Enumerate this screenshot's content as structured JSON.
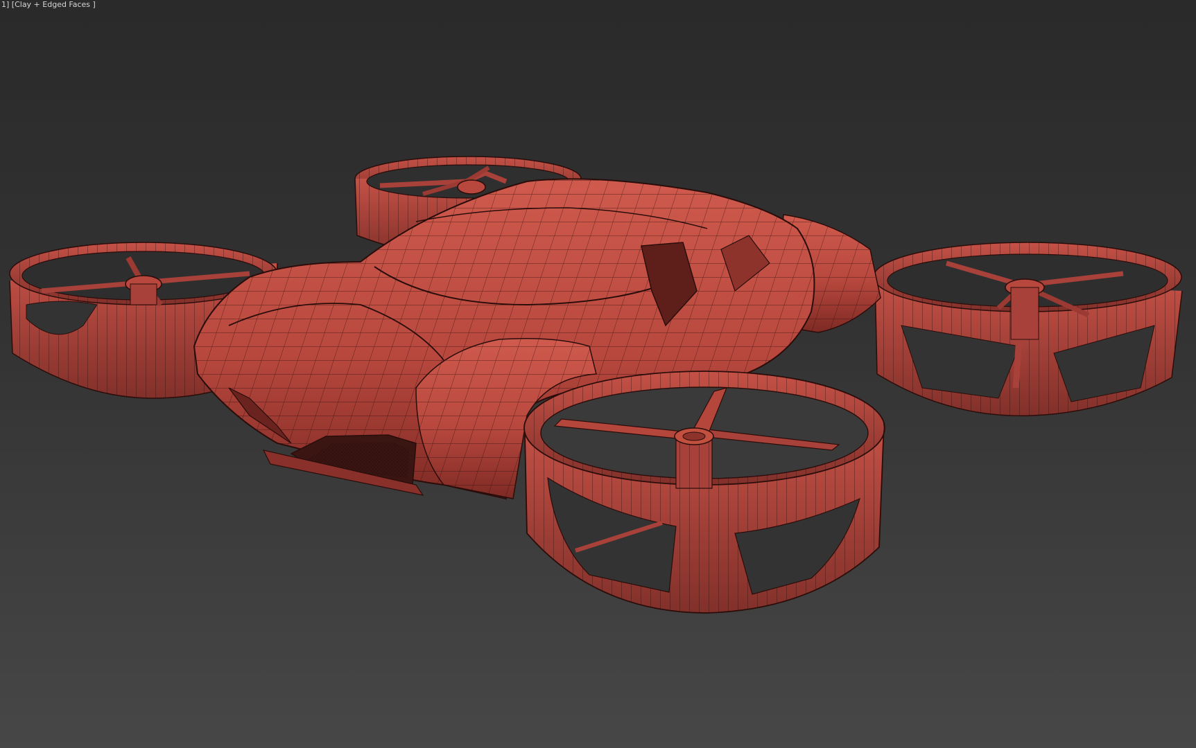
{
  "viewport": {
    "label": "1] [Clay + Edged Faces ]",
    "shading_mode": "Clay + Edged Faces",
    "background_top": "#2a2a2a",
    "background_bottom": "#474747"
  },
  "model": {
    "name": "drone-car",
    "clay_color": "#b8483e",
    "clay_highlight": "#d0594c",
    "clay_shadow": "#7e2a24",
    "wire_color": "#2a0d0a"
  }
}
